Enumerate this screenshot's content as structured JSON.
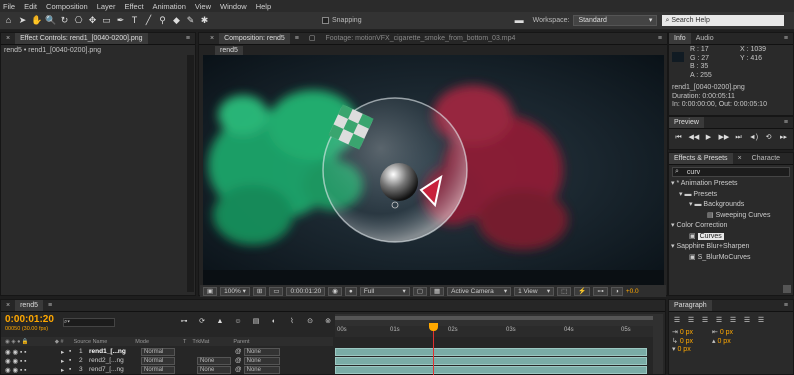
{
  "menu": [
    "File",
    "Edit",
    "Composition",
    "Layer",
    "Effect",
    "Animation",
    "View",
    "Window",
    "Help"
  ],
  "toolbar": {
    "snapping": "Snapping",
    "workspace_label": "Workspace:",
    "workspace_value": "Standard",
    "search_placeholder": "Search Help"
  },
  "left": {
    "tab": "Effect Controls: rend1_[0040-0200].png",
    "breadcrumb": "rend5 • rend1_[0040-0200].png"
  },
  "center": {
    "tab_comp": "Composition: rend5",
    "tab_footage": "Footage: motionVFX_cigarette_smoke_from_bottom_03.mp4",
    "comp_name": "rend5"
  },
  "viewer_bar": {
    "zoom": "100%",
    "timecode": "0:00:01:20",
    "resolution": "Full",
    "camera": "Active Camera",
    "views": "1 View",
    "exposure": "+0.0"
  },
  "info": {
    "tab_info": "Info",
    "tab_audio": "Audio",
    "r": "R : 17",
    "g": "G : 27",
    "b": "B : 35",
    "a": "A : 255",
    "x": "X : 1039",
    "y": "Y : 416",
    "filename": "rend1_[0040-0200].png",
    "duration": "Duration: 0:00:05:11",
    "inout": "In: 0:00:00:00, Out: 0:00:05:10",
    "swatch": "#111b23"
  },
  "preview": {
    "tab": "Preview"
  },
  "effects": {
    "tab": "Effects & Presets",
    "tab2": "Characte",
    "search": "curv",
    "tree": [
      "* Animation Presets",
      "Presets",
      "Backgrounds",
      "Sweeping Curves",
      "Color Correction",
      "Curves",
      "Sapphire Blur+Sharpen",
      "S_BlurMoCurves"
    ]
  },
  "timeline": {
    "tab": "rend5",
    "timecode": "0:00:01:20",
    "frames": "00050 (30.00 fps)",
    "search": "",
    "col_source": "Source Name",
    "col_mode": "Mode",
    "col_t": "T",
    "col_trkmat": "TrkMat",
    "col_parent": "Parent",
    "ruler": [
      "00s",
      "01s",
      "02s",
      "03s",
      "04s",
      "05s"
    ],
    "layers": [
      {
        "num": "1",
        "name": "rend1_[...ng",
        "mode": "Normal",
        "trkmat": "",
        "parent": "None"
      },
      {
        "num": "2",
        "name": "rend2_[...ng",
        "mode": "Normal",
        "trkmat": "None",
        "parent": "None"
      },
      {
        "num": "3",
        "name": "rend7_[...ng",
        "mode": "Normal",
        "trkmat": "None",
        "parent": "None"
      }
    ]
  },
  "paragraph": {
    "tab": "Paragraph",
    "px1": "0 px",
    "px2": "0 px",
    "px3": "0 px",
    "px4": "0 px",
    "px5": "0 px"
  },
  "colors": {
    "accent": "#ffa800",
    "playhead": "#e03030",
    "bar": "#7aaca6"
  }
}
